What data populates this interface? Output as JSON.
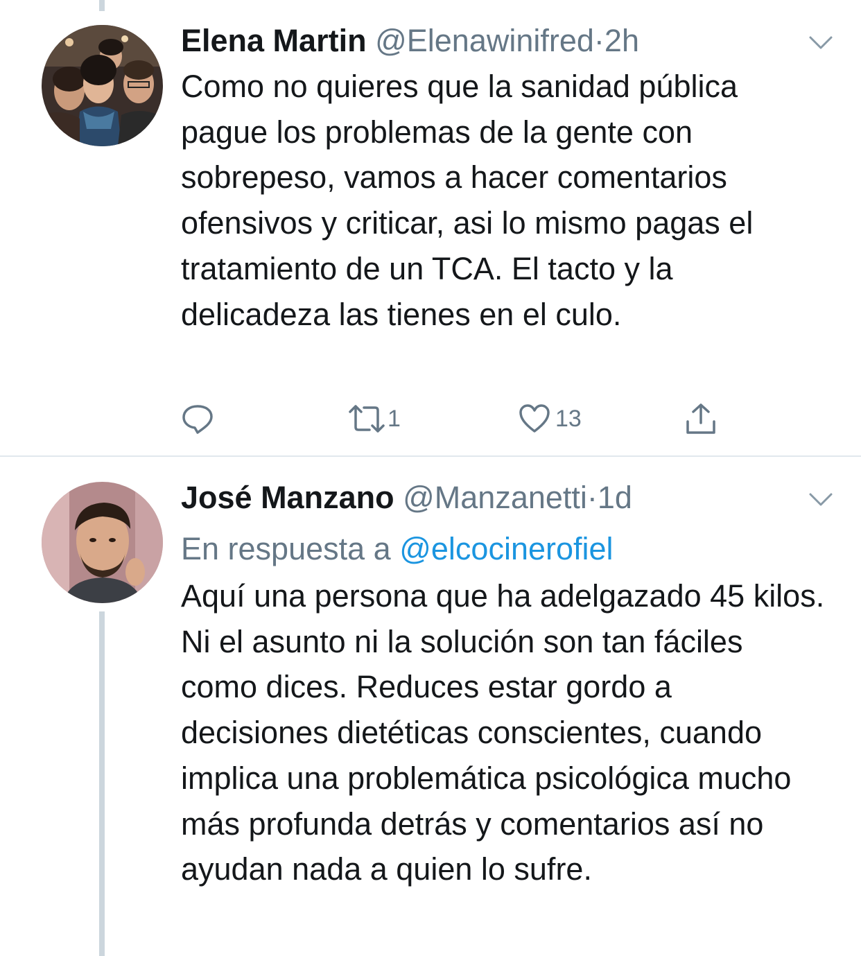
{
  "tweets": [
    {
      "name": "Elena Martin",
      "handle": "@Elenawinifred",
      "separator": "·",
      "time": "2h",
      "text": "Como no quieres que la sanidad pública pague los problemas de la gente con sobrepeso, vamos a hacer comentarios ofensivos y criticar, asi lo mismo pagas el tratamiento de un TCA. El tacto y la delicadeza las tienes en el culo.",
      "actions": {
        "retweet_count": "1",
        "like_count": "13"
      }
    },
    {
      "name": "José Manzano",
      "handle": "@Manzanetti",
      "separator": "·",
      "time": "1d",
      "reply_prefix": "En respuesta a",
      "reply_mention": "@elcocinerofiel",
      "text": "Aquí una persona que ha adelgazado 45 kilos. Ni el asunto ni la solución son tan fáciles como dices. Reduces estar gordo a decisiones dietéticas conscientes, cuando implica una problemática psicológica mucho más profunda detrás y comentarios así no ayudan nada a quien lo sufre."
    }
  ],
  "colors": {
    "accent": "#1b95e0",
    "secondary": "#657786",
    "divider": "#e1e8ed",
    "thread": "#ccd6dd"
  },
  "icons": [
    "reply-icon",
    "retweet-icon",
    "like-icon",
    "share-icon",
    "chevron-down-icon"
  ]
}
